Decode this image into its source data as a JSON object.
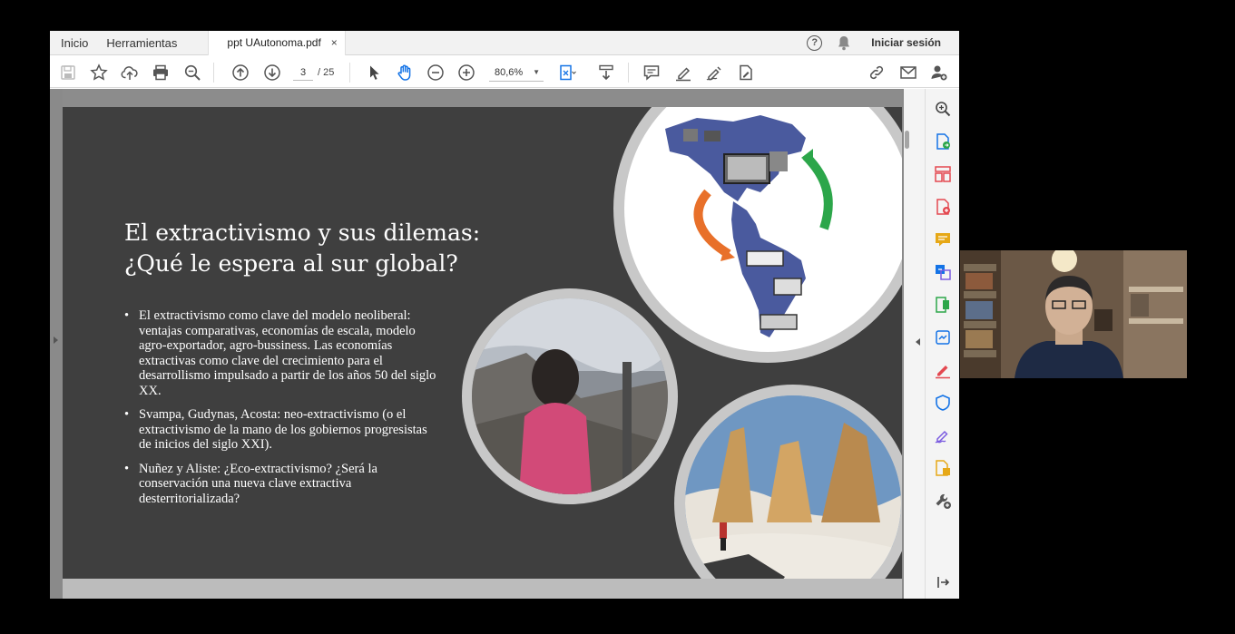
{
  "menubar": {
    "items": [
      "Inicio",
      "Herramientas"
    ],
    "tab_title": "ppt UAutonoma.pdf",
    "tab_close": "×",
    "help": "?",
    "signin": "Iniciar sesión"
  },
  "toolbar": {
    "icons": [
      "save-icon",
      "star-icon",
      "upload-icon",
      "print-icon",
      "search-zoom-icon",
      "page-up-icon",
      "page-down-icon",
      "pointer-icon",
      "hand-icon",
      "zoom-out-icon",
      "zoom-in-icon",
      "fit-page-icon",
      "scroll-mode-icon",
      "comment-icon",
      "highlight-icon",
      "sign-icon",
      "fill-sign-icon",
      "link-icon",
      "mail-icon",
      "add-user-icon"
    ],
    "page_current": "3",
    "page_total": "/ 25",
    "zoom": "80,6%"
  },
  "slide": {
    "title_line1": "El extractivismo y sus dilemas:",
    "title_line2": "¿Qué le espera al sur global?",
    "bullets": [
      "El extractivismo como clave del modelo neoliberal: ventajas comparativas, economías de escala, modelo agro-exportador, agro-bussiness. Las economías extractivas como clave del crecimiento para el desarrollismo impulsado a partir de los años 50 del siglo XX.",
      "Svampa, Gudynas, Acosta: neo-extractivismo (o el extractivismo de la mano de los gobiernos progresistas de inicios del siglo XXI).",
      "Nuñez y Aliste: ¿Eco-extractivismo? ¿Será la conservación una nueva clave extractiva desterritorializada?"
    ]
  },
  "rightpane": {
    "icons": [
      "zoom-tool-icon",
      "export-pdf-icon",
      "organize-pages-icon",
      "create-pdf-icon",
      "comment-tool-icon",
      "combine-files-icon",
      "edit-pdf-icon",
      "scan-enhance-icon",
      "fill-sign-tool-icon",
      "protect-icon",
      "signature-icon",
      "compare-icon",
      "more-tools-icon",
      "collapse-pane-icon"
    ]
  },
  "colors": {
    "slide_bg": "#3f3f3f",
    "accent_blue": "#1473e6",
    "accent_red": "#e34850",
    "accent_yellow": "#e6a817",
    "accent_purple": "#7b5ce0"
  }
}
